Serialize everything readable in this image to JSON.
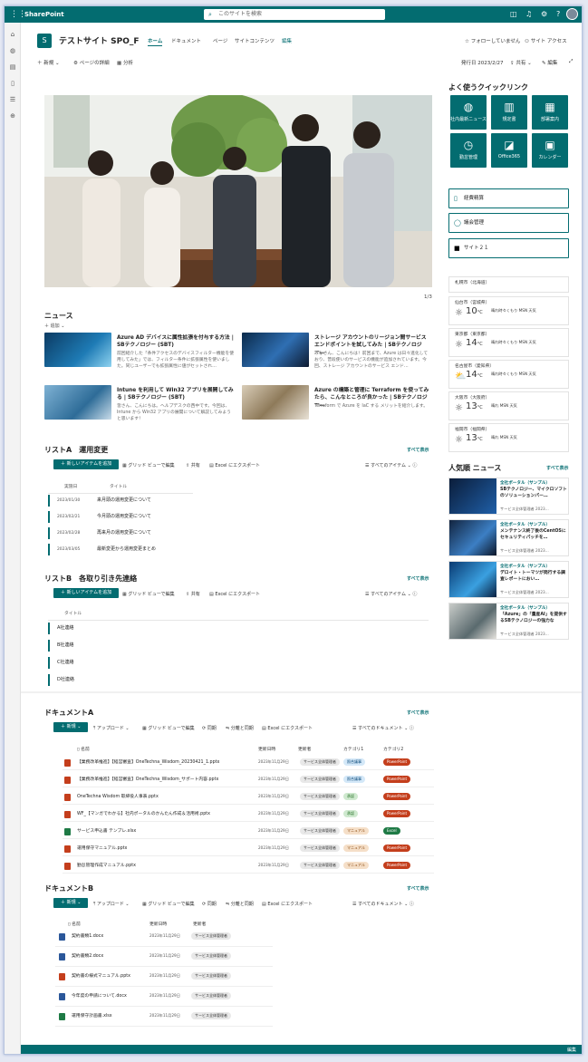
{
  "suite": {
    "brand": "SharePoint",
    "search_placeholder": "このサイトを検索"
  },
  "site": {
    "logo_letter": "S",
    "title": "テストサイト SPO_F",
    "nav": [
      "ホーム",
      "ドキュメント",
      "ページ",
      "サイトコンテンツ"
    ],
    "edit": "編集",
    "follow": "フォローしていません",
    "access": "サイト アクセス"
  },
  "commands": {
    "new": "新規",
    "details": "ページの詳細",
    "analytics": "分析",
    "published": "発行日 2023/2/27",
    "share": "共有",
    "edit": "編集"
  },
  "hero": {
    "page": "1/3"
  },
  "news": {
    "title": "ニュース",
    "add": "追加",
    "items": [
      {
        "title": "Azure AD デバイスに属性拡張を付与する方法 | SBテクノロジー (SBT)",
        "desc": "前回紹介した「条件アクセスのデバイスフィルター機能を使用してみた」では、フィルター条件に拡張属性を使いました。同じユーザーでも拡張属性に値がセットされ…"
      },
      {
        "title": "ストレージ アカウントのリージョン間サービス エンドポイントを試してみた | SBテクノロジー…",
        "desc": "みなさん、こんにちは！前回まで、Azure は日々進化しており、普段使いのサービスの機能が追加されています。今回、ストレージ アカウントのサービス エンド…"
      },
      {
        "title": "Intune を利用して Win32 アプリを展開してみる | SBテクノロジー (SBT)",
        "desc": "皆さん、こんにちは。ヘルプデスクの西中です。今回は、Intune から Win32 アプリの展開について解説してみようと思います！"
      },
      {
        "title": "Azure の構築と管理に Terraform を使ってみたら、こんなところが良かった | SBテクノロジー…",
        "desc": "Terraform で Azure を IaC する メリットを紹介します。"
      }
    ]
  },
  "listA": {
    "title": "リストA　運用変更",
    "see_all": "すべて表示",
    "new_item": "新しいアイテムを追加",
    "grid": "グリッド ビューで編集",
    "share": "共有",
    "export": "Excel にエクスポート",
    "view": "すべてのアイテム",
    "col_date": "実施日",
    "col_title": "タイトル",
    "rows": [
      {
        "date": "2023/01/30",
        "title": "来月頭の運用変更について"
      },
      {
        "date": "2023/02/21",
        "title": "今月頭の運用変更について"
      },
      {
        "date": "2023/02/28",
        "title": "再来月の運用変更について"
      },
      {
        "date": "2023/03/05",
        "title": "最新変更から運用変更まとめ"
      }
    ]
  },
  "listB": {
    "title": "リストB　各取り引き先連絡",
    "see_all": "すべて表示",
    "new_item": "新しいアイテムを追加",
    "grid": "グリッド ビューで編集",
    "share": "共有",
    "export": "Excel にエクスポート",
    "view": "すべてのアイテム",
    "col_title": "タイトル",
    "rows": [
      "A社連絡",
      "B社連絡",
      "C社連絡",
      "D社連絡"
    ]
  },
  "quicklinks": {
    "title": "よく使うクイックリンク",
    "tiles": [
      {
        "icon": "globe-icon",
        "label": "社内最新ニュース"
      },
      {
        "icon": "book-icon",
        "label": "規定書"
      },
      {
        "icon": "building-icon",
        "label": "部署案内"
      },
      {
        "icon": "clock-icon",
        "label": "勤怠管理"
      },
      {
        "icon": "office-icon",
        "label": "Office365"
      },
      {
        "icon": "calendar-icon",
        "label": "カレンダー"
      }
    ],
    "links": [
      {
        "icon": "doc-icon",
        "label": "経費精算"
      },
      {
        "icon": "ring-icon",
        "label": "議会管理"
      },
      {
        "icon": "logo-icon",
        "label": "サイト２１"
      }
    ]
  },
  "weather": [
    {
      "city": "札幌市（北海道）",
      "temp": "10",
      "cond": "晴れ",
      "unit": "°C"
    },
    {
      "city": "仙台市（宮城県）",
      "temp": "10",
      "cond": "晴れ時々くもり",
      "unit": "°C"
    },
    {
      "city": "東京都（東京都）",
      "temp": "14",
      "cond": "晴れ時々くもり",
      "unit": "°C"
    },
    {
      "city": "名古屋市（愛知県）",
      "temp": "14",
      "cond": "晴れ時々くもり",
      "unit": "°C"
    },
    {
      "city": "大阪市（大阪府）",
      "temp": "13",
      "cond": "晴れ",
      "unit": "°C"
    },
    {
      "city": "福岡市（福岡県）",
      "temp": "13",
      "cond": "晴れ",
      "unit": "°C"
    }
  ],
  "weather_meta": "MSN 天気",
  "popular": {
    "title": "人気順 ニュース",
    "see_all": "すべて表示",
    "items": [
      {
        "cat": "全社ポータル（サンプル）",
        "title": "SBテクノロジー、マイクロソフトのソリューションパー…",
        "meta": "サービス全体管理者 2023…"
      },
      {
        "cat": "全社ポータル（サンプル）",
        "title": "メンテナンス終了後のCentOSにセキュリティパッチを…",
        "meta": "サービス全体管理者 2023…"
      },
      {
        "cat": "全社ポータル（サンプル）",
        "title": "デロイト・トーマツが発行する調査レポートにおい…",
        "meta": "サービス全体管理者 2023…"
      },
      {
        "cat": "全社ポータル（サンプル）",
        "title": "「Azure」の「量産AI」を提供するSBテクノロジーの強力な",
        "meta": "サービス全体管理者 2023…"
      }
    ]
  },
  "docA": {
    "title": "ドキュメントA",
    "see_all": "すべて表示",
    "new": "新規",
    "upload": "アップロード",
    "grid": "グリッド ビューで編集",
    "sync": "同期",
    "share": "分離と同期",
    "export": "Excel にエクスポート",
    "view": "すべてのドキュメント",
    "cols": [
      "名前",
      "更新日時",
      "更新者",
      "カテゴリ1",
      "カテゴリ2"
    ],
    "rows": [
      {
        "name": "【業務改革推進】【経営審査】OneTechna_Wisdom_20230421_1.pptx",
        "date": "2023年11月29日",
        "by": "サービス全体管理者",
        "c1": "照合議事",
        "c1t": "blue",
        "c2": "PowerPoint",
        "c2t": "ppt",
        "icon": "ppt"
      },
      {
        "name": "【業務改革推進】【経営審査】OneTechna_Wisdom_サポート内容.pptx",
        "date": "2023年11月29日",
        "by": "サービス全体管理者",
        "c1": "照合議事",
        "c1t": "blue",
        "c2": "PowerPoint",
        "c2t": "ppt",
        "icon": "ppt"
      },
      {
        "name": "OneTechna Wisdom 取締役人事表.pptx",
        "date": "2023年11月29日",
        "by": "サービス全体管理者",
        "c1": "承認",
        "c1t": "green",
        "c2": "PowerPoint",
        "c2t": "ppt",
        "icon": "ppt"
      },
      {
        "name": "WF_【マンガでわかる】社内ポータルのかんたん作成＆活用術.pptx",
        "date": "2023年11月29日",
        "by": "サービス全体管理者",
        "c1": "承認",
        "c1t": "green",
        "c2": "PowerPoint",
        "c2t": "ppt",
        "icon": "ppt"
      },
      {
        "name": "サービス申込書 テンプレ.xlsx",
        "date": "2023年11月29日",
        "by": "サービス全体管理者",
        "c1": "マニュアル",
        "c1t": "orange",
        "c2": "Excel",
        "c2t": "excel",
        "icon": "xls"
      },
      {
        "name": "運用保守マニュアル.pptx",
        "date": "2023年11月29日",
        "by": "サービス全体管理者",
        "c1": "マニュアル",
        "c1t": "orange",
        "c2": "PowerPoint",
        "c2t": "ppt",
        "icon": "ppt"
      },
      {
        "name": "勤怠管理作成マニュアル.pptx",
        "date": "2023年11月29日",
        "by": "サービス全体管理者",
        "c1": "マニュアル",
        "c1t": "orange",
        "c2": "PowerPoint",
        "c2t": "ppt",
        "icon": "ppt"
      }
    ]
  },
  "docB": {
    "title": "ドキュメントB",
    "see_all": "すべて表示",
    "new": "新規",
    "upload": "アップロード",
    "grid": "グリッド ビューで編集",
    "sync": "同期",
    "share": "分離と同期",
    "export": "Excel にエクスポート",
    "view": "すべてのドキュメント",
    "cols": [
      "名前",
      "更新日時",
      "更新者"
    ],
    "rows": [
      {
        "name": "契約書類1.docx",
        "date": "2023年11月29日",
        "by": "サービス全体管理者",
        "icon": "doc"
      },
      {
        "name": "契約書類2.docx",
        "date": "2023年11月29日",
        "by": "サービス全体管理者",
        "icon": "doc"
      },
      {
        "name": "契約書の様式マニュアル.pptx",
        "date": "2023年11月29日",
        "by": "サービス全体管理者",
        "icon": "ppt"
      },
      {
        "name": "今年度の申請について.docx",
        "date": "2023年11月29日",
        "by": "サービス全体管理者",
        "icon": "doc"
      },
      {
        "name": "運用保守計画書.xlsx",
        "date": "2023年11月29日",
        "by": "サービス全体管理者",
        "icon": "xls"
      }
    ]
  },
  "footer": {
    "edit": "編集"
  }
}
